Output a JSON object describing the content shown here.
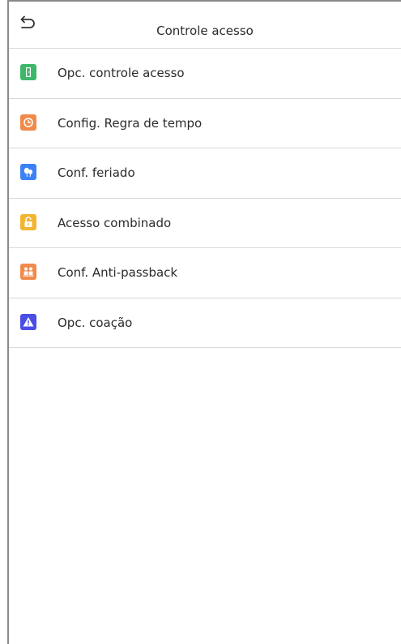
{
  "header": {
    "title": "Controle acesso",
    "back_icon": "back-arrow-icon"
  },
  "menu": {
    "items": [
      {
        "label": "Opc. controle acesso",
        "icon": "door-icon",
        "color": "#3db86a"
      },
      {
        "label": "Config. Regra de tempo",
        "icon": "clock-icon",
        "color": "#f08a4b"
      },
      {
        "label": "Conf. feriado",
        "icon": "balloon-icon",
        "color": "#3b82f6"
      },
      {
        "label": "Acesso combinado",
        "icon": "unlock-icon",
        "color": "#f2b532"
      },
      {
        "label": "Conf. Anti-passback",
        "icon": "people-icon",
        "color": "#f08a4b"
      },
      {
        "label": "Opc. coação",
        "icon": "warning-icon",
        "color": "#4a4ee6"
      }
    ]
  }
}
